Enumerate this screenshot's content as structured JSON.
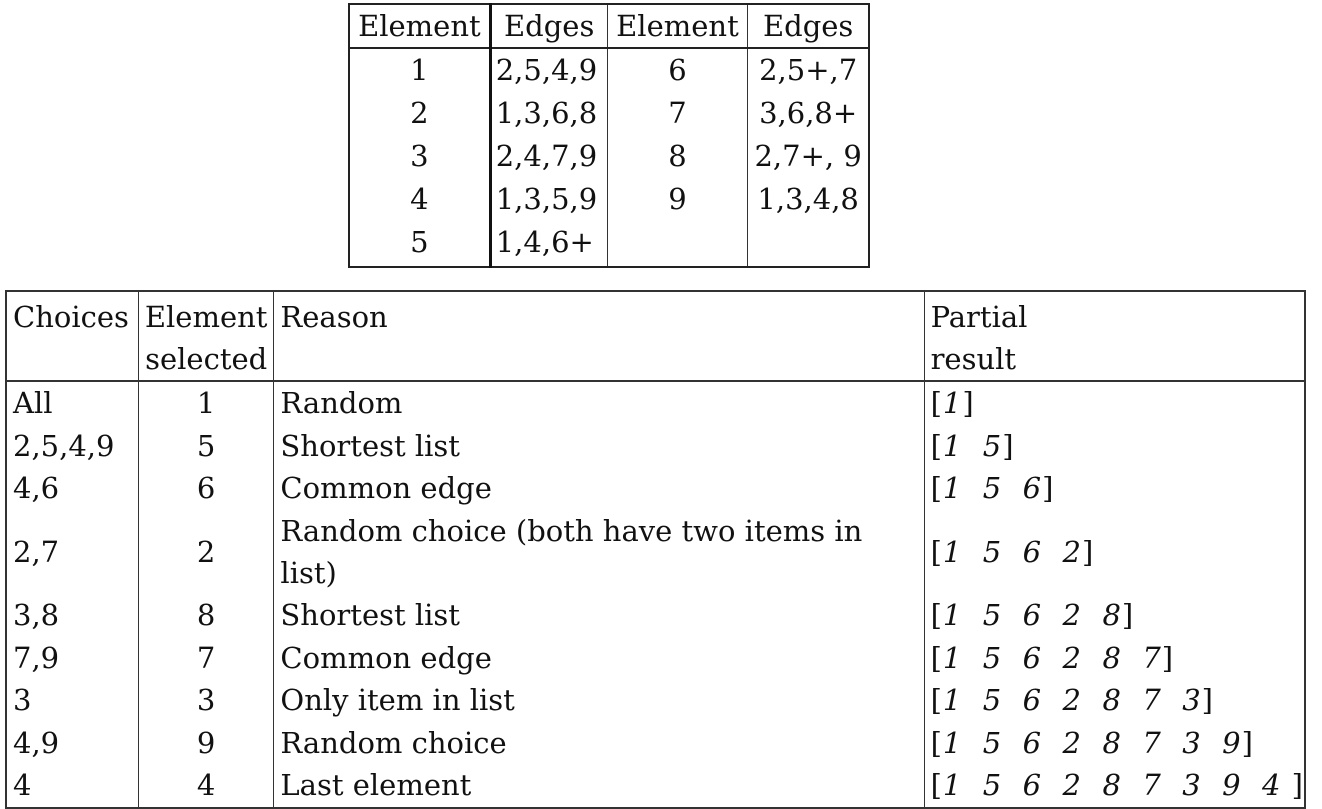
{
  "edges_table": {
    "headers": [
      "Element",
      "Edges",
      "Element",
      "Edges"
    ],
    "rows": [
      {
        "element_a": "1",
        "edges_a": "2,5,4,9",
        "element_b": "6",
        "edges_b": "2,5+,7"
      },
      {
        "element_a": "2",
        "edges_a": "1,3,6,8",
        "element_b": "7",
        "edges_b": "3,6,8+"
      },
      {
        "element_a": "3",
        "edges_a": "2,4,7,9",
        "element_b": "8",
        "edges_b": "2,7+, 9"
      },
      {
        "element_a": "4",
        "edges_a": "1,3,5,9",
        "element_b": "9",
        "edges_b": "1,3,4,8"
      },
      {
        "element_a": "5",
        "edges_a": "1,4,6+",
        "element_b": "",
        "edges_b": ""
      }
    ]
  },
  "steps_table": {
    "headers": {
      "choices": "Choices",
      "element_selected_line1": "Element",
      "element_selected_line2": "selected",
      "reason": "Reason",
      "partial_result_line1": "Partial",
      "partial_result_line2": "result"
    },
    "rows": [
      {
        "choices": "All",
        "element": "1",
        "reason": "Random",
        "partial": "1"
      },
      {
        "choices": "2,5,4,9",
        "element": "5",
        "reason": "Shortest list",
        "partial": "1  5"
      },
      {
        "choices": "4,6",
        "element": "6",
        "reason": "Common edge",
        "partial": "1  5  6"
      },
      {
        "choices": "2,7",
        "element": "2",
        "reason": "Random choice (both have two items in list)",
        "partial": "1  5  6  2"
      },
      {
        "choices": "3,8",
        "element": "8",
        "reason": "Shortest list",
        "partial": "1  5  6  2  8"
      },
      {
        "choices": "7,9",
        "element": "7",
        "reason": "Common edge",
        "partial": "1  5  6  2  8  7"
      },
      {
        "choices": "3",
        "element": "3",
        "reason": "Only item in list",
        "partial": "1  5  6  2  8  7  3"
      },
      {
        "choices": "4,9",
        "element": "9",
        "reason": "Random choice",
        "partial": "1  5  6  2  8  7  3  9"
      },
      {
        "choices": "4",
        "element": "4",
        "reason": "Last element",
        "partial": "1  5  6  2  8  7  3  9  4 "
      }
    ],
    "bracket_open": "[",
    "bracket_close": "]"
  }
}
